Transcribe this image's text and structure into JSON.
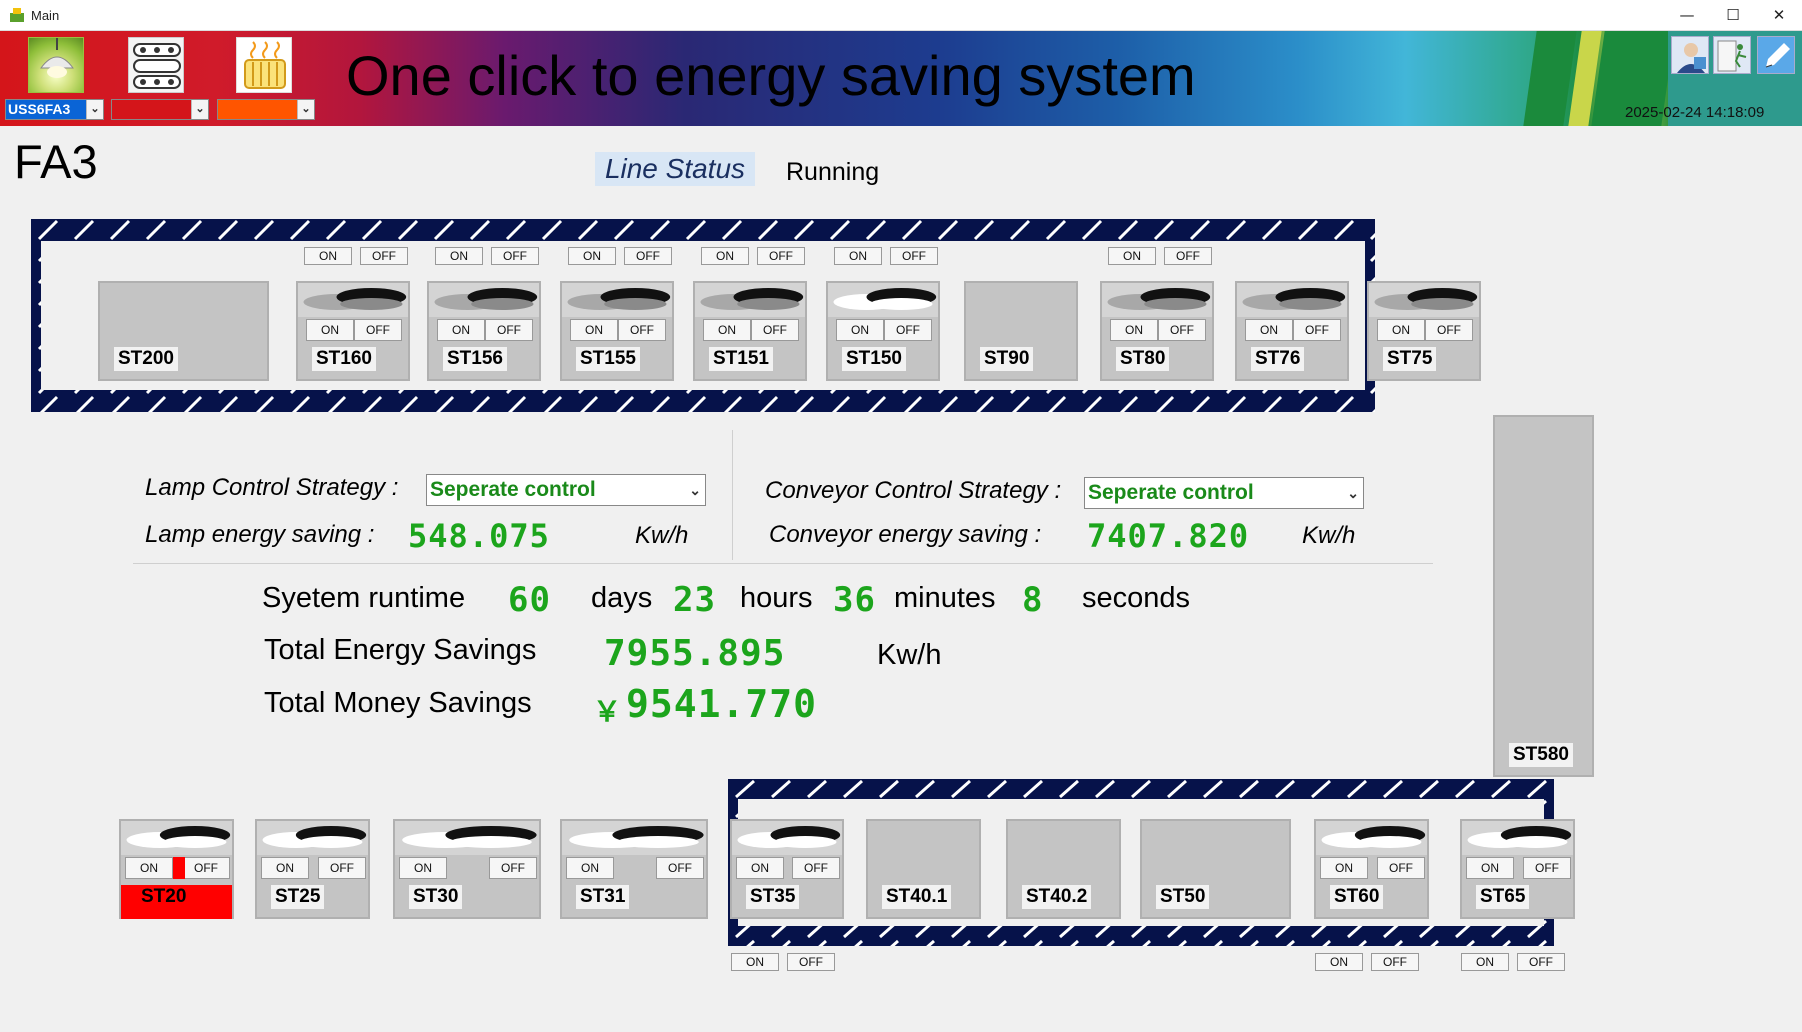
{
  "window": {
    "title": "Main",
    "min": "—",
    "max": "☐",
    "close": "✕"
  },
  "banner": {
    "title": "One click to energy saving system",
    "datetime": "2025-02-24 14:18:09",
    "device_select": "USS6FA3",
    "select2": "",
    "select3": ""
  },
  "header": {
    "area": "FA3",
    "line_status_label": "Line Status",
    "line_status_value": "Running"
  },
  "buttons": {
    "on": "ON",
    "off": "OFF"
  },
  "top_stations": [
    "ST200",
    "ST160",
    "ST156",
    "ST155",
    "ST151",
    "ST150",
    "ST90",
    "ST80",
    "ST76",
    "ST75"
  ],
  "side_station": "ST580",
  "bottom_stations": [
    "ST20",
    "ST25",
    "ST30",
    "ST31",
    "ST35",
    "ST40.1",
    "ST40.2",
    "ST50",
    "ST60",
    "ST65"
  ],
  "strategy": {
    "lamp_label": "Lamp Control Strategy :",
    "lamp_value": "Seperate control",
    "conveyor_label": "Conveyor Control Strategy :",
    "conveyor_value": "Seperate control",
    "lamp_saving_label": "Lamp energy saving :",
    "lamp_saving_value": "548.075",
    "conveyor_saving_label": "Conveyor energy saving :",
    "conveyor_saving_value": "7407.820",
    "unit": "Kw/h"
  },
  "runtime": {
    "label": "Syetem runtime",
    "days": "60",
    "days_label": "days",
    "hours": "23",
    "hours_label": "hours",
    "minutes": "36",
    "minutes_label": "minutes",
    "seconds": "8",
    "seconds_label": "seconds"
  },
  "totals": {
    "energy_label": "Total Energy Savings",
    "energy_value": "7955.895",
    "energy_unit": "Kw/h",
    "money_label": "Total Money Savings",
    "currency": "￥",
    "money_value": "9541.770"
  },
  "colors": {
    "accent_green": "#1ca51c",
    "track": "#06124a",
    "alert_red": "#ff0000"
  }
}
